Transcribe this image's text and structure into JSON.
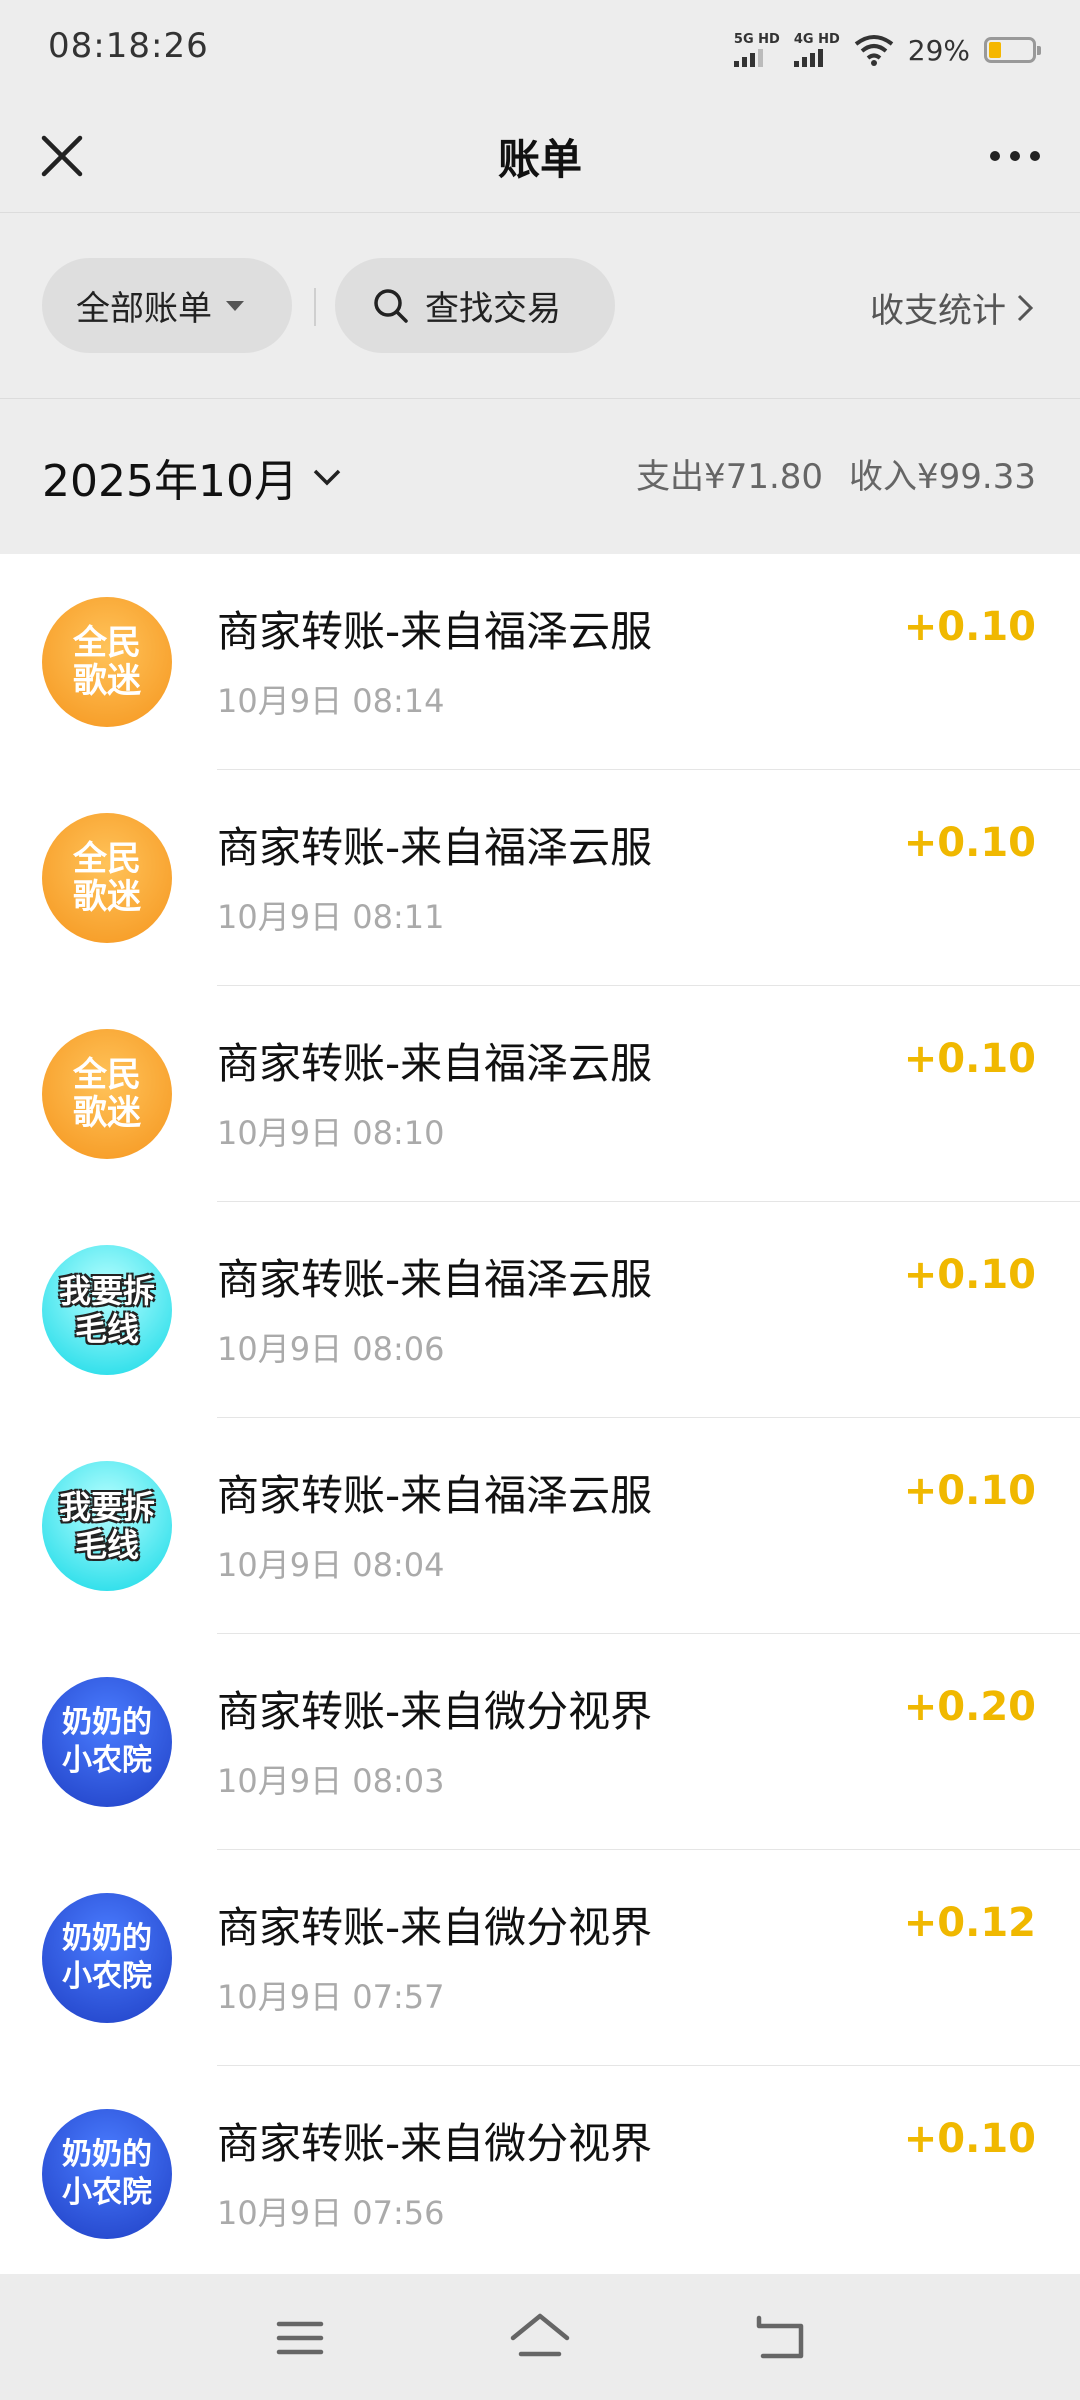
{
  "status_bar": {
    "time": "08:18:26",
    "sim1_label": "5G HD",
    "sim2_label": "4G HD",
    "battery_percent": "29%",
    "battery_level": 0.29
  },
  "nav": {
    "title": "账单",
    "close_icon": "close-icon",
    "more_icon": "more-icon"
  },
  "filter": {
    "all_bills_label": "全部账单",
    "search_label": "查找交易",
    "stats_label": "收支统计"
  },
  "month": {
    "label": "2025年10月",
    "expense": "支出¥71.80",
    "income": "收入¥99.33"
  },
  "transactions": [
    {
      "avatar_text": [
        "全民",
        "歌迷"
      ],
      "avatar_style": "orange",
      "title": "商家转账-来自福泽云服",
      "time": "10月9日 08:14",
      "amount": "+0.10"
    },
    {
      "avatar_text": [
        "全民",
        "歌迷"
      ],
      "avatar_style": "orange",
      "title": "商家转账-来自福泽云服",
      "time": "10月9日 08:11",
      "amount": "+0.10"
    },
    {
      "avatar_text": [
        "全民",
        "歌迷"
      ],
      "avatar_style": "orange",
      "title": "商家转账-来自福泽云服",
      "time": "10月9日 08:10",
      "amount": "+0.10"
    },
    {
      "avatar_text": [
        "我要拆",
        "毛线"
      ],
      "avatar_style": "cyan",
      "title": "商家转账-来自福泽云服",
      "time": "10月9日 08:06",
      "amount": "+0.10"
    },
    {
      "avatar_text": [
        "我要拆",
        "毛线"
      ],
      "avatar_style": "cyan",
      "title": "商家转账-来自福泽云服",
      "time": "10月9日 08:04",
      "amount": "+0.10"
    },
    {
      "avatar_text": [
        "奶奶的",
        "小农院"
      ],
      "avatar_style": "blue",
      "title": "商家转账-来自微分视界",
      "time": "10月9日 08:03",
      "amount": "+0.20"
    },
    {
      "avatar_text": [
        "奶奶的",
        "小农院"
      ],
      "avatar_style": "blue",
      "title": "商家转账-来自微分视界",
      "time": "10月9日 07:57",
      "amount": "+0.12"
    },
    {
      "avatar_text": [
        "奶奶的",
        "小农院"
      ],
      "avatar_style": "blue",
      "title": "商家转账-来自微分视界",
      "time": "10月9日 07:56",
      "amount": "+0.10"
    }
  ],
  "system_nav": {
    "menu_icon": "menu-icon",
    "home_icon": "home-icon",
    "back_icon": "back-icon"
  },
  "colors": {
    "amount": "#f0b800",
    "background": "#ededed"
  }
}
